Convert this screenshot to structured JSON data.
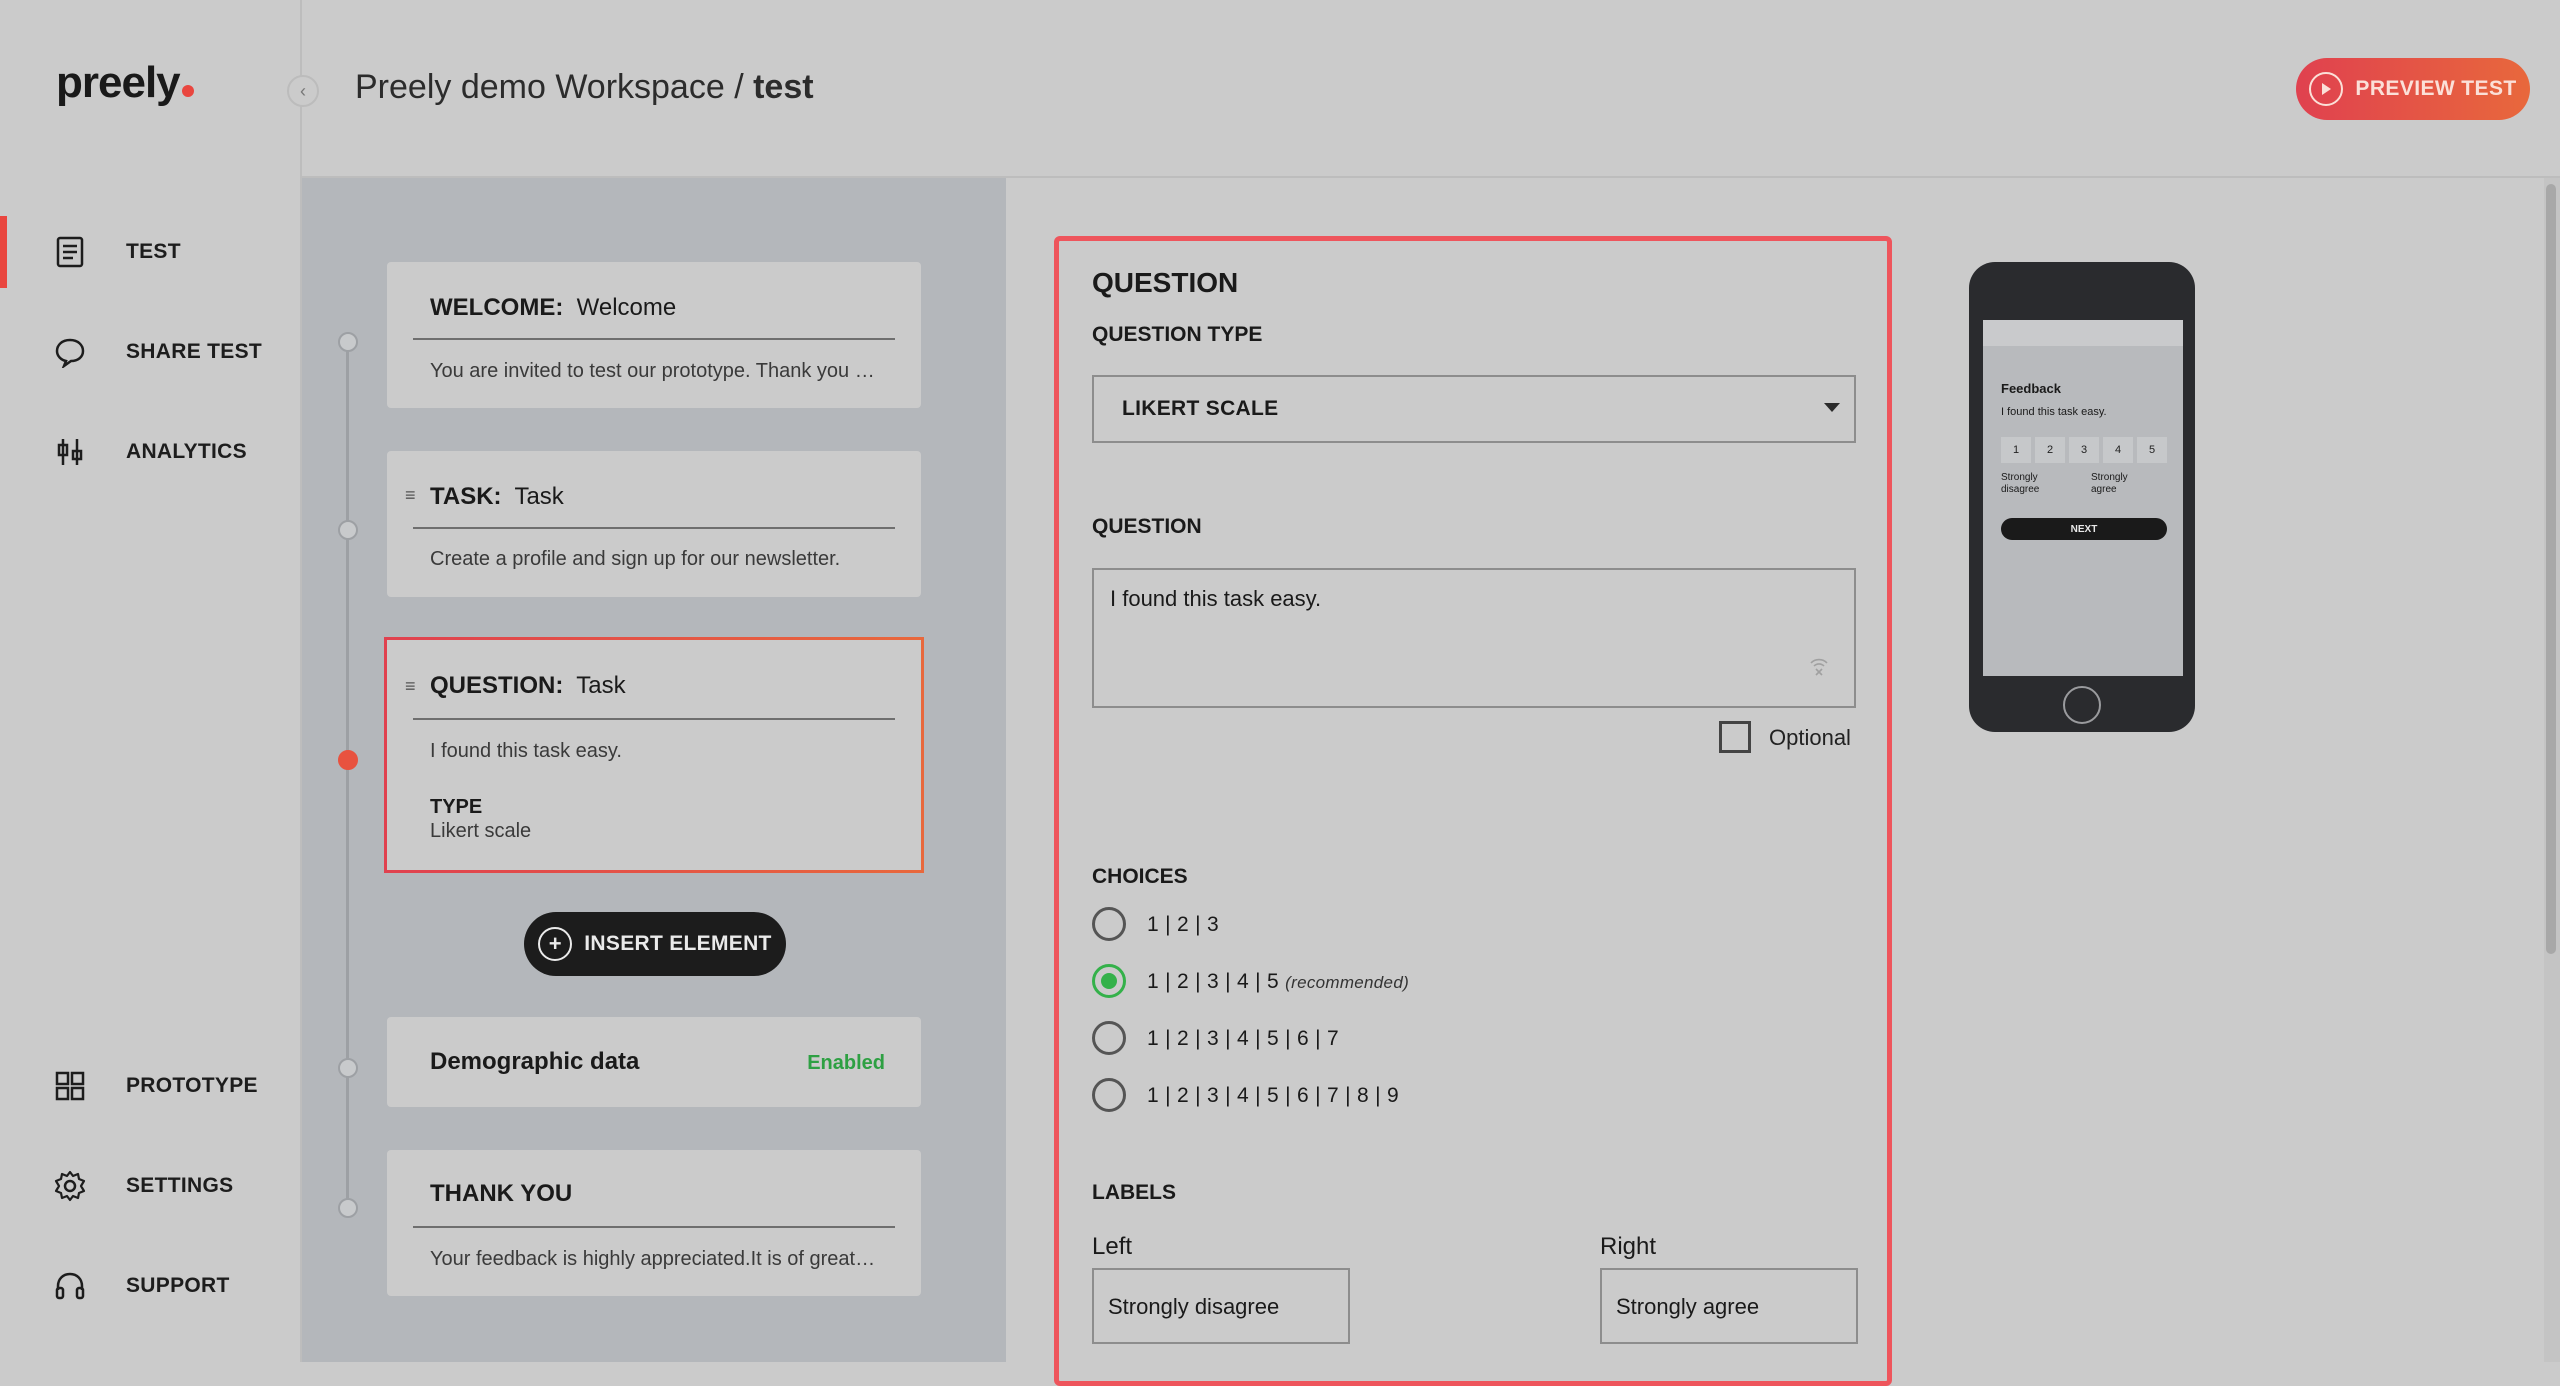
{
  "app": {
    "logo": "preely"
  },
  "sidebar": {
    "top_items": [
      {
        "label": "TEST",
        "icon": "document-icon"
      },
      {
        "label": "SHARE TEST",
        "icon": "chat-bubble-icon"
      },
      {
        "label": "ANALYTICS",
        "icon": "analytics-icon"
      }
    ],
    "bottom_items": [
      {
        "label": "PROTOTYPE",
        "icon": "grid-icon"
      },
      {
        "label": "SETTINGS",
        "icon": "gear-icon"
      },
      {
        "label": "SUPPORT",
        "icon": "headset-icon"
      }
    ],
    "active_item": "TEST",
    "accent_color": "#e9463f"
  },
  "header": {
    "workspace": "Preely demo Workspace",
    "separator": "/",
    "test_name": "test",
    "preview_label": "PREVIEW TEST"
  },
  "flow": {
    "cards": [
      {
        "type_label": "WELCOME:",
        "name": "Welcome",
        "description": "You are invited to test our prototype. Thank you for participating."
      },
      {
        "type_label": "TASK:",
        "name": "Task",
        "description": "Create a profile and sign up for our newsletter."
      },
      {
        "type_label": "QUESTION:",
        "name": "Task",
        "description": "I found this task easy.",
        "type_caption": "TYPE",
        "type_value": "Likert scale"
      },
      {
        "name": "Demographic data",
        "status": "Enabled"
      },
      {
        "name": "THANK YOU",
        "description": "Your feedback is highly appreciated.It is of great value to us."
      }
    ],
    "insert_label": "INSERT ELEMENT",
    "status_color": "#2ea043"
  },
  "form": {
    "heading": "QUESTION",
    "question_type_label": "QUESTION TYPE",
    "question_type_value": "LIKERT SCALE",
    "question_label": "QUESTION",
    "question_value": "I found this task easy.",
    "optional_label": "Optional",
    "choices_label": "CHOICES",
    "choices": [
      {
        "label": "1 | 2 | 3",
        "note": ""
      },
      {
        "label": "1 | 2 | 3 | 4 | 5",
        "note": "(recommended)"
      },
      {
        "label": "1 | 2 | 3 | 4 | 5 | 6 | 7",
        "note": ""
      },
      {
        "label": "1 | 2 | 3 | 4 | 5 | 6 | 7 | 8 | 9",
        "note": ""
      }
    ],
    "selected_choice": 1,
    "labels_heading": "LABELS",
    "left_caption": "Left",
    "left_value": "Strongly disagree",
    "right_caption": "Right",
    "right_value": "Strongly agree",
    "border_color": "#ee555c",
    "selected_color": "#34b14a"
  },
  "phone_preview": {
    "title": "Feedback",
    "question": "I found this task easy.",
    "scale": [
      "1",
      "2",
      "3",
      "4",
      "5"
    ],
    "left_label": "Strongly disagree",
    "right_label": "Strongly agree",
    "next_label": "NEXT"
  }
}
